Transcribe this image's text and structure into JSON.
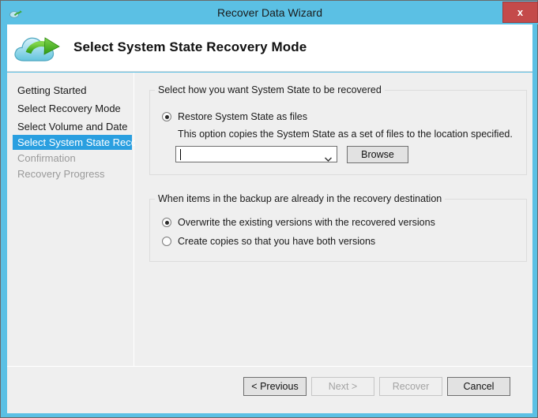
{
  "window": {
    "title": "Recover Data Wizard",
    "title_icon": "cloud-icon",
    "close_label": "x",
    "accent_color": "#5bc0e4",
    "close_color": "#c44a4a"
  },
  "header": {
    "icon": "cloud-recovery-icon",
    "title": "Select System State Recovery Mode"
  },
  "sidebar": {
    "items": [
      {
        "label": "Getting Started",
        "state": "done"
      },
      {
        "label": "Select Recovery Mode",
        "state": "done"
      },
      {
        "label": "Select Volume and Date",
        "state": "done"
      },
      {
        "label": "Select System State Reco...",
        "state": "active"
      },
      {
        "label": "Confirmation",
        "state": "disabled"
      },
      {
        "label": "Recovery Progress",
        "state": "disabled"
      }
    ],
    "active_color": "#2a9fe0"
  },
  "main": {
    "group_recovery": {
      "legend": "Select how you want System State to be recovered",
      "option_label": "Restore System State as files",
      "option_checked": true,
      "description": "This option copies the System State as a set of files to the location specified.",
      "path_value": "",
      "path_placeholder": "",
      "combo_arrow_icon": "chevron-down-icon",
      "browse_label": "Browse"
    },
    "group_conflict": {
      "legend": "When items in the backup are already in the recovery destination",
      "options": [
        {
          "label": "Overwrite the existing versions with the recovered versions",
          "checked": true
        },
        {
          "label": "Create copies so that you have both versions",
          "checked": false
        }
      ]
    }
  },
  "footer": {
    "buttons": [
      {
        "label": "< Previous",
        "enabled": true
      },
      {
        "label": "Next >",
        "enabled": false
      },
      {
        "label": "Recover",
        "enabled": false
      },
      {
        "label": "Cancel",
        "enabled": true
      }
    ]
  }
}
